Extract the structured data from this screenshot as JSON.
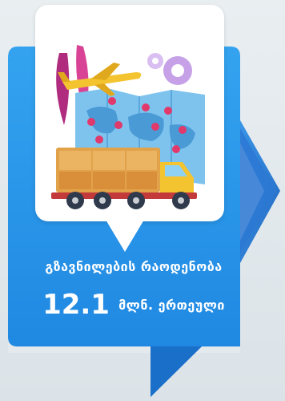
{
  "infographic": {
    "label": "გზავნილების რაოდენობა",
    "value": "12.1",
    "unit": "მლნ. ერთეული"
  },
  "colors": {
    "panel_blue": "#1e88e5",
    "panel_blue_light": "#35a4f0",
    "arrow_blue": "#2c7fd6",
    "card_white": "#ffffff",
    "text_white": "#ffffff"
  },
  "icons": {
    "illustration": "logistics-illustration",
    "airplane": "airplane-icon",
    "truck": "delivery-truck-icon",
    "map": "world-map-icon",
    "gear": "gear-icon",
    "location_pin": "location-pin-icon"
  }
}
